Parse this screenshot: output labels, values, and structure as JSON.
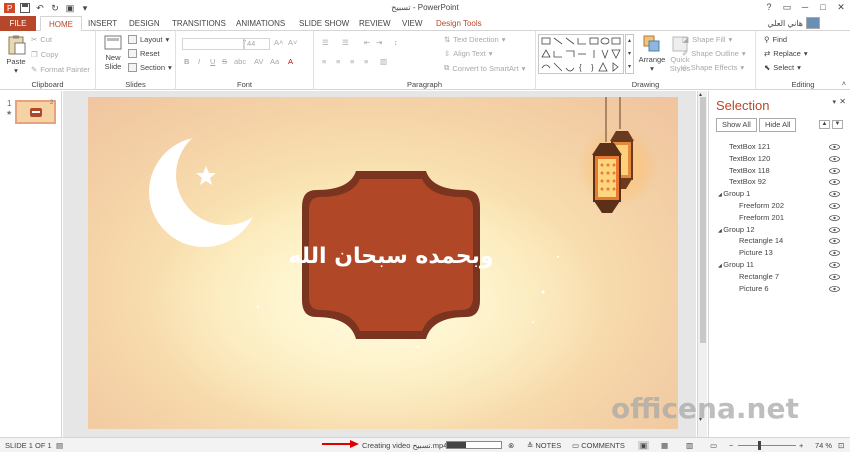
{
  "window": {
    "title": "تسبيح - PowerPoint",
    "user": "هاني العلي"
  },
  "tabs": [
    {
      "label": "FILE"
    },
    {
      "label": "HOME"
    },
    {
      "label": "INSERT"
    },
    {
      "label": "DESIGN"
    },
    {
      "label": "TRANSITIONS"
    },
    {
      "label": "ANIMATIONS"
    },
    {
      "label": "SLIDE SHOW"
    },
    {
      "label": "REVIEW"
    },
    {
      "label": "VIEW"
    },
    {
      "label": "Design Tools"
    }
  ],
  "ribbon": {
    "clipboard": {
      "paste": "Paste",
      "cut": "Cut",
      "copy": "Copy",
      "format_painter": "Format Painter",
      "label": "Clipboard"
    },
    "slides": {
      "new_slide": "New Slide",
      "layout": "Layout",
      "reset": "Reset",
      "section": "Section",
      "label": "Slides"
    },
    "font": {
      "size": "44",
      "bold": "B",
      "italic": "I",
      "underline": "U",
      "strike": "S",
      "shadow": "abc",
      "label": "Font"
    },
    "paragraph": {
      "text_direction": "Text Direction",
      "align_text": "Align Text",
      "convert_smartart": "Convert to SmartArt",
      "label": "Paragraph"
    },
    "drawing": {
      "arrange": "Arrange",
      "quick_styles": "Quick Styles",
      "shape_fill": "Shape Fill",
      "shape_outline": "Shape Outline",
      "shape_effects": "Shape Effects",
      "label": "Drawing"
    },
    "editing": {
      "find": "Find",
      "replace": "Replace",
      "select": "Select",
      "label": "Editing"
    }
  },
  "slide_panel": {
    "number": "1",
    "star": "★",
    "anim_badge": "2"
  },
  "slide": {
    "title_text": "وبحمده سبحان الله"
  },
  "selection_pane": {
    "title": "Selection",
    "show_all": "Show All",
    "hide_all": "Hide All",
    "items": [
      {
        "label": "TextBox 121",
        "level": 0
      },
      {
        "label": "TextBox 120",
        "level": 0
      },
      {
        "label": "TextBox 118",
        "level": 0
      },
      {
        "label": "TextBox 92",
        "level": 0
      },
      {
        "label": "Group 1",
        "level": 0,
        "group": true
      },
      {
        "label": "Freeform 202",
        "level": 1
      },
      {
        "label": "Freeform 201",
        "level": 1
      },
      {
        "label": "Group 12",
        "level": 0,
        "group": true
      },
      {
        "label": "Rectangle 14",
        "level": 1
      },
      {
        "label": "Picture 13",
        "level": 1
      },
      {
        "label": "Group 11",
        "level": 0,
        "group": true
      },
      {
        "label": "Rectangle 7",
        "level": 1
      },
      {
        "label": "Picture 6",
        "level": 1
      }
    ]
  },
  "statusbar": {
    "slide_info": "SLIDE 1 OF 1",
    "creating_video": "Creating video تسبيح.mp4",
    "video_progress": 0.35,
    "notes": "NOTES",
    "comments": "COMMENTS",
    "zoom": "74 %"
  },
  "watermark": "officena.net",
  "colors": {
    "accent": "#b7472a",
    "plaque": "#b04828",
    "plaque_border": "#7a3420"
  }
}
